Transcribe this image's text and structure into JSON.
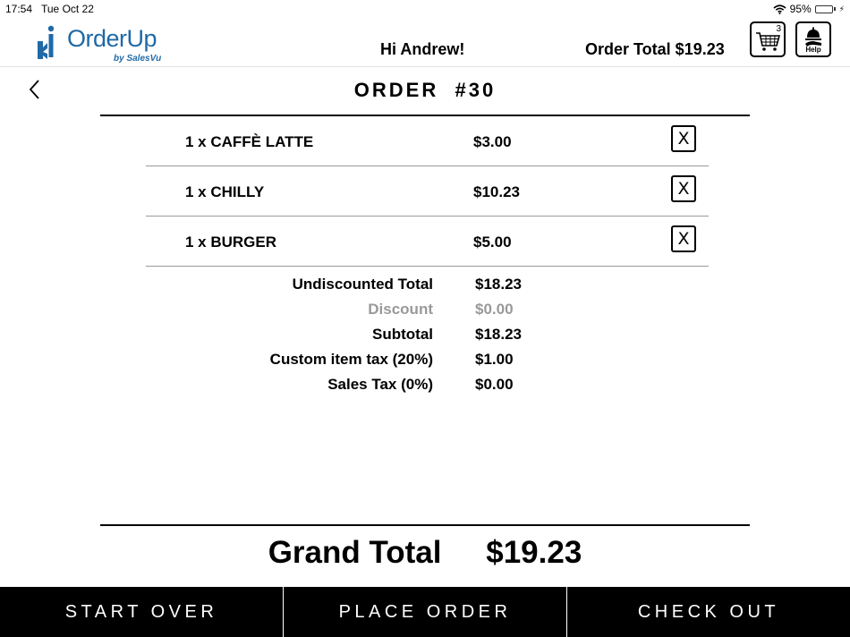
{
  "status": {
    "time": "17:54",
    "date": "Tue Oct 22",
    "battery": "95%",
    "battery_level": 0.95
  },
  "header": {
    "logo_text": "OrderUp",
    "logo_sub": "by SalesVu",
    "greeting": "Hi Andrew!",
    "order_total": "Order Total $19.23",
    "cart_count": "3",
    "help_label": "Help"
  },
  "order": {
    "title": "ORDER  #30",
    "remove_label": "X",
    "items": [
      {
        "name": "1 x CAFFÈ LATTE",
        "price": "$3.00"
      },
      {
        "name": "1 x CHILLY",
        "price": "$10.23"
      },
      {
        "name": "1 x BURGER",
        "price": "$5.00"
      }
    ]
  },
  "totals": {
    "undiscounted_label": "Undiscounted Total",
    "undiscounted_value": "$18.23",
    "discount_label": "Discount",
    "discount_value": "$0.00",
    "subtotal_label": "Subtotal",
    "subtotal_value": "$18.23",
    "custom_tax_label": "Custom item tax (20%)",
    "custom_tax_value": "$1.00",
    "sales_tax_label": "Sales Tax (0%)",
    "sales_tax_value": "$0.00"
  },
  "grand_total": {
    "label": "Grand Total",
    "value": "$19.23"
  },
  "footer": {
    "start_over": "START OVER",
    "place_order": "PLACE ORDER",
    "check_out": "CHECK OUT"
  },
  "colors": {
    "brand": "#1f69a6",
    "muted": "#999999",
    "footer_bg": "#000000",
    "battery": "#33c94a"
  }
}
